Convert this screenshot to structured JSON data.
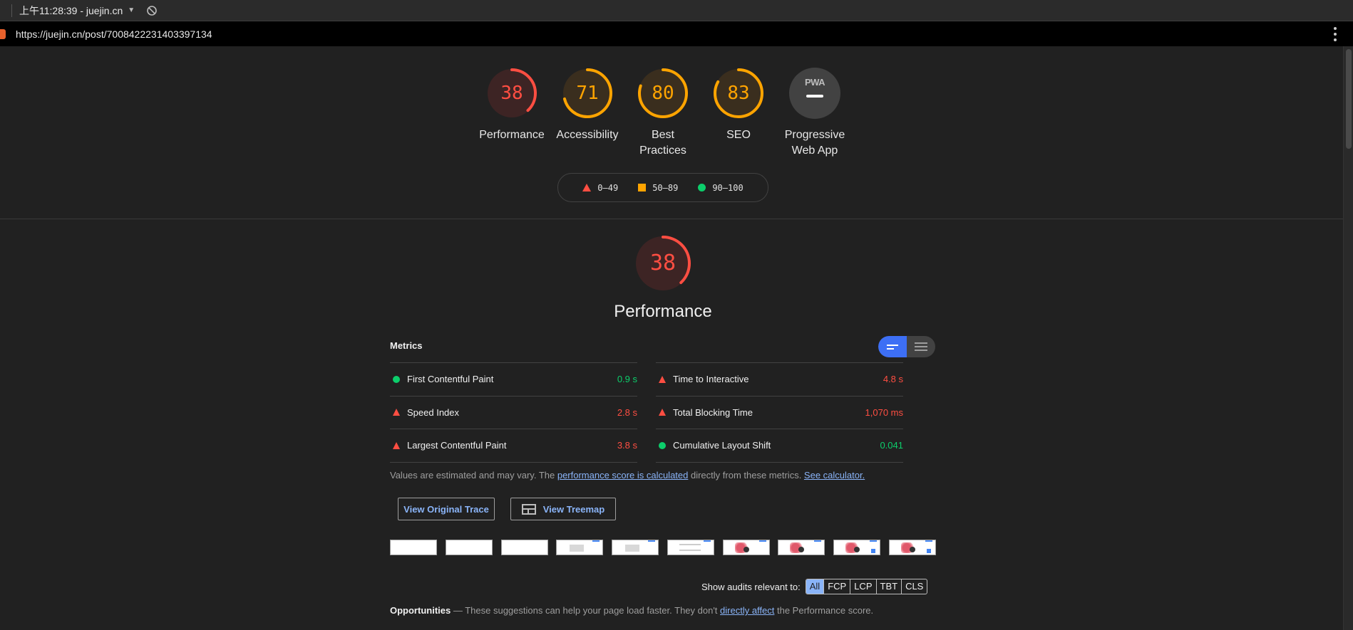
{
  "topbar": {
    "timestamp": "上午11:28:39 - juejin.cn",
    "block_icon": "block-icon"
  },
  "urlbar": {
    "url": "https://juejin.cn/post/7008422231403397134",
    "menu_icon": "more-vert-icon"
  },
  "gauges": [
    {
      "label": "Performance",
      "score": "38",
      "color": "#ff4e42"
    },
    {
      "label": "Accessibility",
      "score": "71",
      "color": "#ffa400"
    },
    {
      "label": "Best Practices",
      "score": "80",
      "color": "#ffa400"
    },
    {
      "label": "SEO",
      "score": "83",
      "color": "#ffa400"
    }
  ],
  "pwa": {
    "badge_text": "PWA",
    "label": "Progressive Web App"
  },
  "legend": {
    "fail": "0–49",
    "average": "50–89",
    "pass": "90–100"
  },
  "performance": {
    "score": "38",
    "title": "Performance",
    "metrics_label": "Metrics",
    "metrics": [
      {
        "name": "First Contentful Paint",
        "value": "0.9 s",
        "status": "pass"
      },
      {
        "name": "Time to Interactive",
        "value": "4.8 s",
        "status": "fail"
      },
      {
        "name": "Speed Index",
        "value": "2.8 s",
        "status": "fail"
      },
      {
        "name": "Total Blocking Time",
        "value": "1,070 ms",
        "status": "fail"
      },
      {
        "name": "Largest Contentful Paint",
        "value": "3.8 s",
        "status": "fail"
      },
      {
        "name": "Cumulative Layout Shift",
        "value": "0.041",
        "status": "pass"
      }
    ],
    "note": {
      "prefix": "Values are estimated and may vary. The ",
      "link1": "performance score is calculated",
      "middle": " directly from these metrics. ",
      "link2": "See calculator."
    },
    "buttons": {
      "trace": "View Original Trace",
      "treemap": "View Treemap"
    }
  },
  "filter": {
    "label": "Show audits relevant to:",
    "chips": [
      "All",
      "FCP",
      "LCP",
      "TBT",
      "CLS"
    ],
    "active": "All"
  },
  "opportunities": {
    "title": "Opportunities",
    "dash": " — ",
    "text": "These suggestions can help your page load faster. They don't ",
    "link": "directly affect",
    "suffix": " the Performance score."
  },
  "colors": {
    "fail": "#ff4e42",
    "average": "#ffa400",
    "pass": "#0cce6b",
    "link": "#8ab4f8",
    "toggle_active": "#3d6ff5"
  }
}
